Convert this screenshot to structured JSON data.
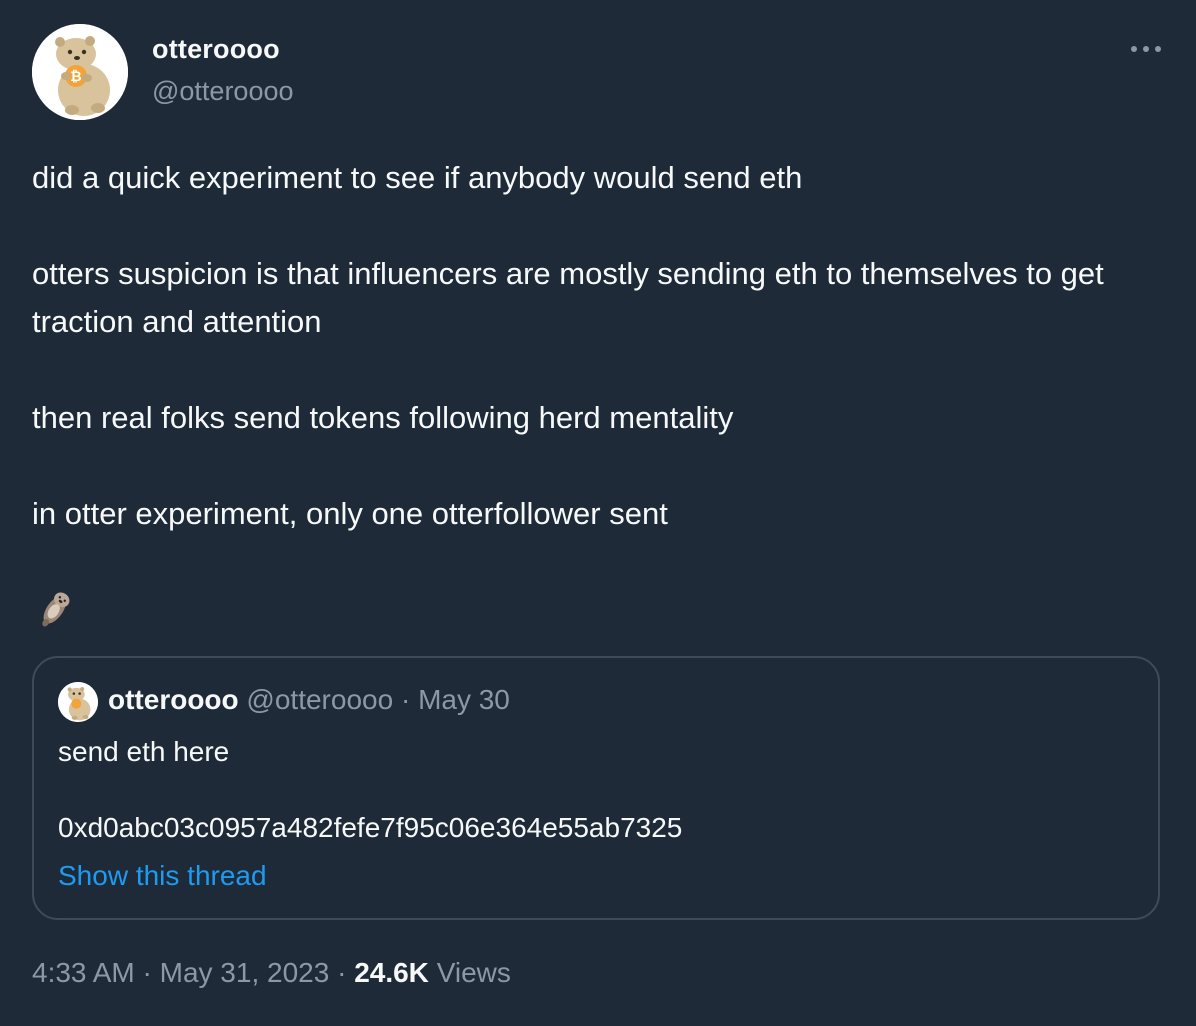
{
  "author": {
    "display_name": "otteroooo",
    "handle": "@otteroooo",
    "avatar_icon": "otter-bitcoin-avatar-icon"
  },
  "menu": {
    "more_icon": "more-horizontal-icon"
  },
  "tweet": {
    "paragraphs": [
      "did a quick experiment to see if anybody would send eth",
      "otters suspicion is that influencers are mostly sending eth to themselves to get traction and attention",
      "then real folks send tokens following herd mentality",
      "in otter experiment, only one otterfollower sent"
    ],
    "emoji_icon": "otter-emoji-icon"
  },
  "quote": {
    "display_name": "otteroooo",
    "handle": "@otteroooo",
    "separator": "·",
    "date": "May 30",
    "line1": "send eth here",
    "line2": "0xd0abc03c0957a482fefe7f95c06e364e55ab7325",
    "show_thread": "Show this thread"
  },
  "meta": {
    "time": "4:33 AM",
    "sep1": "·",
    "date": "May 31, 2023",
    "sep2": "·",
    "views_count": "24.6K",
    "views_label": "Views"
  },
  "colors": {
    "background": "#1e2a38",
    "text_primary": "#f7f9f9",
    "text_secondary": "#8b98a5",
    "link": "#1d9bf0",
    "border": "#3d4b5a"
  }
}
